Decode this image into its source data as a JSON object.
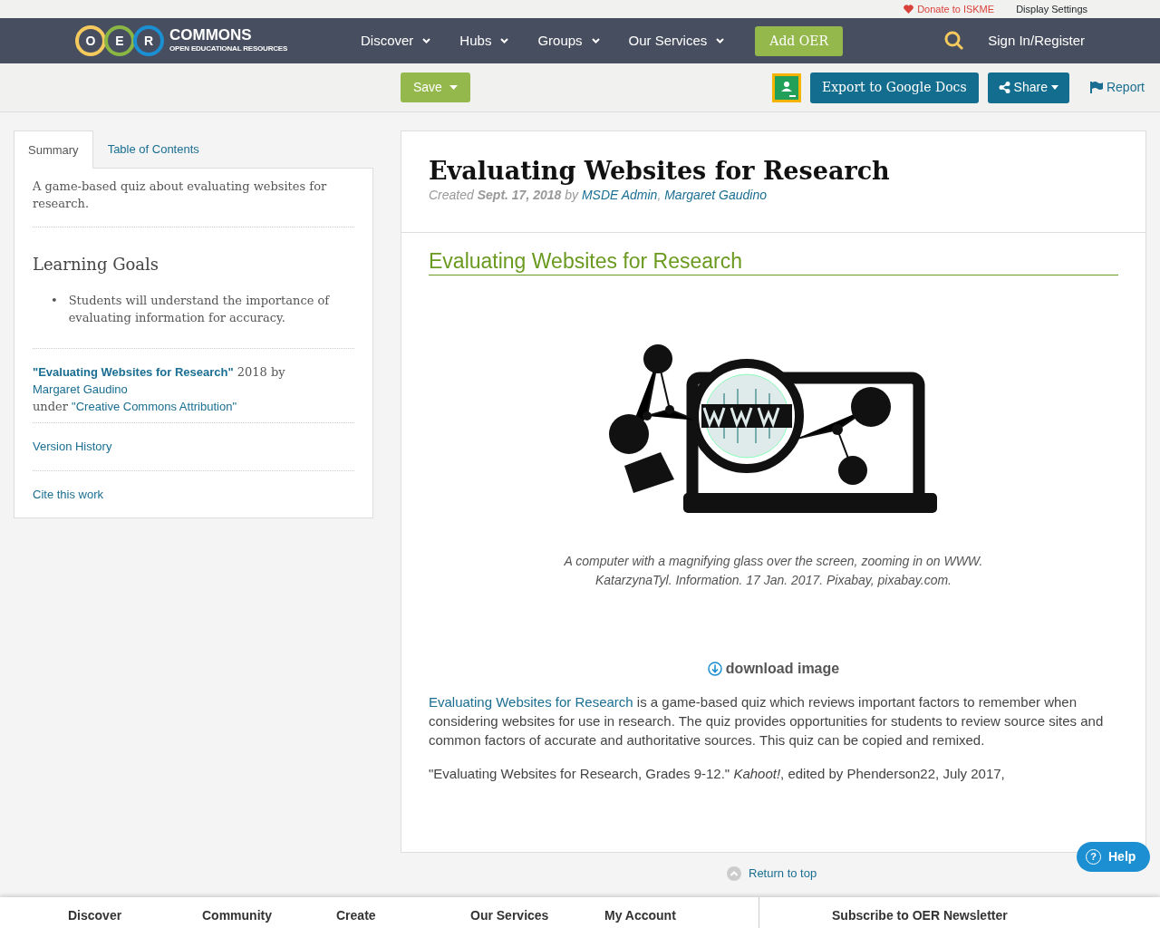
{
  "top_bar": {
    "donate": "Donate to ISKME",
    "display_settings": "Display Settings"
  },
  "nav": {
    "logo": {
      "letters": [
        "O",
        "E",
        "R"
      ],
      "name": "COMMONS",
      "tagline": "OPEN EDUCATIONAL RESOURCES"
    },
    "menu": [
      "Discover",
      "Hubs",
      "Groups",
      "Our Services"
    ],
    "add_button": "Add OER",
    "sign_in": "Sign In/Register"
  },
  "toolbar": {
    "save": "Save",
    "export": "Export to Google Docs",
    "share": "Share",
    "report": "Report"
  },
  "sidebar": {
    "tabs": [
      {
        "label": "Summary",
        "selected": true
      },
      {
        "label": "Table of Contents",
        "selected": false
      }
    ],
    "summary": "A game-based quiz about evaluating websites for research.",
    "goals_heading": "Learning Goals",
    "goals": [
      {
        "marker": "•",
        "text": "Students will understand the importance of evaluating information for accuracy."
      }
    ],
    "attribution": [
      {
        "kind": "title-link",
        "text": "\"Evaluating Websites for Research\""
      },
      {
        "kind": "text",
        "text": " 2018 by "
      },
      {
        "kind": "link",
        "text": "Margaret Gaudino"
      },
      {
        "kind": "break",
        "text": "under "
      },
      {
        "kind": "link",
        "text": "\"Creative Commons Attribution\""
      }
    ],
    "links": [
      "Version History",
      "Cite this work"
    ]
  },
  "main": {
    "title": "Evaluating Websites for Research",
    "meta": [
      {
        "kind": "text",
        "text": "Created "
      },
      {
        "kind": "bold",
        "text": "Sept. 17, 2018"
      },
      {
        "kind": "text",
        "text": " by "
      },
      {
        "kind": "link",
        "text": "MSDE Admin"
      },
      {
        "kind": "text",
        "text": ", "
      },
      {
        "kind": "link",
        "text": "Margaret Gaudino"
      }
    ],
    "section_heading": "Evaluating Websites for Research",
    "caption": [
      "A computer with a magnifying glass over the screen, zooming in on WWW.",
      "KatarzynaTyl. Information. 17 Jan. 2017. Pixabay, pixabay.com."
    ],
    "download": "download image",
    "description": [
      {
        "kind": "link",
        "text": "Evaluating Websites for Research"
      },
      {
        "kind": "text",
        "text": " is a game-based quiz which reviews important factors to remember when considering websites for use in research. The quiz provides opportunities for students to review source sites and common factors of accurate and authoritative sources. This quiz can be copied and remixed."
      }
    ],
    "citation": "\"Evaluating Websites for Research, Grades 9-12.\" *Kahoot!*, edited by Phenderson22, July 2017,"
  },
  "return_to_top": "Return to top",
  "help": {
    "icon": "?",
    "label": "Help"
  },
  "footer": [
    "Discover",
    "Community",
    "Create",
    "Our Services",
    "My Account",
    "Subscribe to OER Newsletter"
  ]
}
